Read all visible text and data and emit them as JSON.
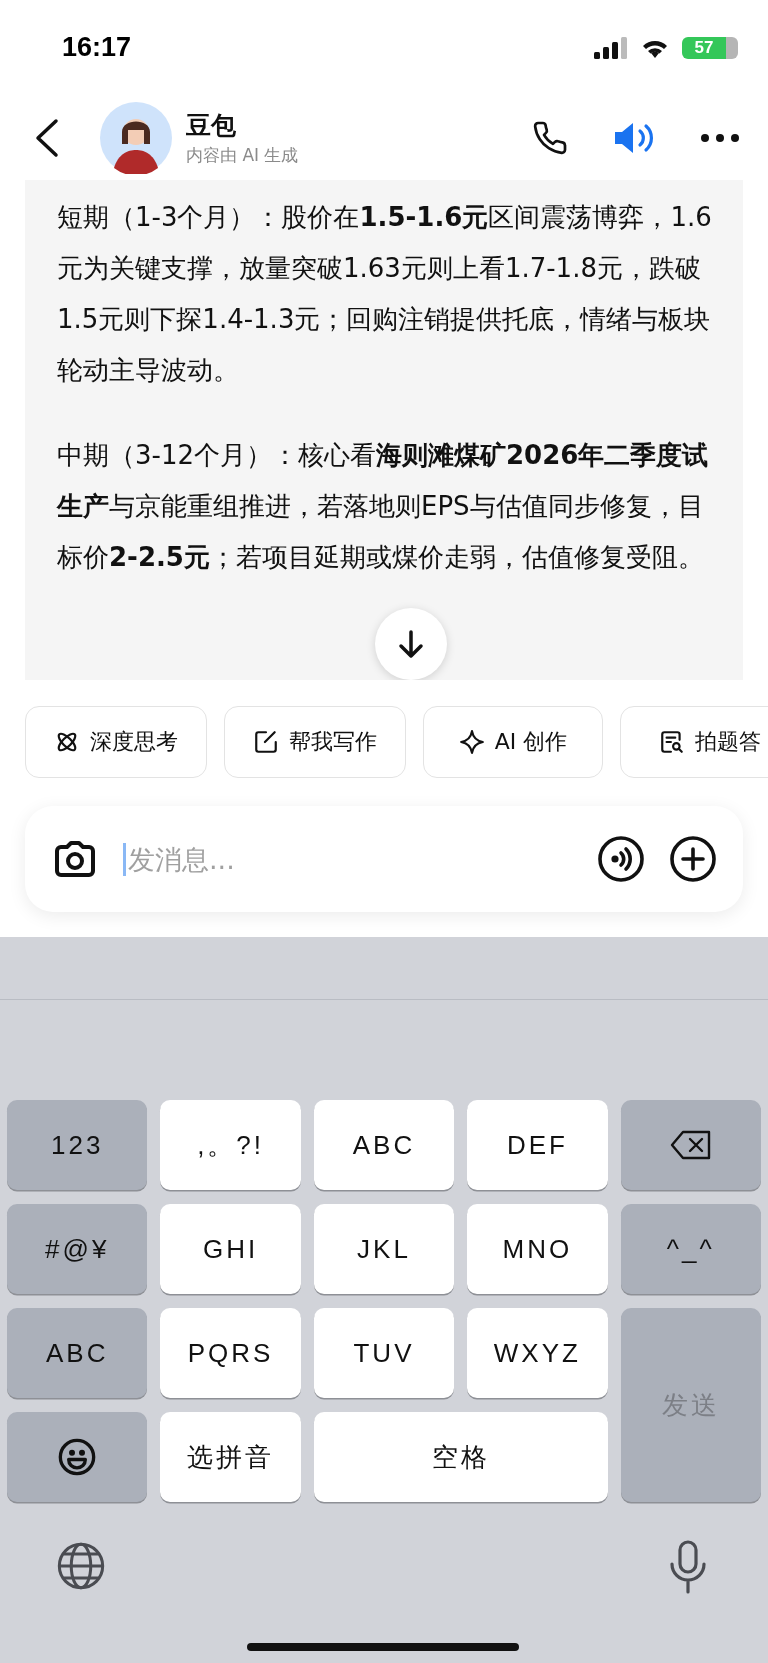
{
  "status_bar": {
    "time": "16:17",
    "battery": "57"
  },
  "header": {
    "title": "豆包",
    "subtitle": "内容由 AI 生成"
  },
  "message": {
    "paragraphs": [
      "短期（1-3个月）：股价在**1.5-1.6元**区间震荡博弈，1.6元为关键支撑，放量突破1.63元则上看1.7-1.8元，跌破1.5元则下探1.4-1.3元；回购注销提供托底，情绪与板块轮动主导波动。",
      "中期（3-12个月）：核心看**海则滩煤矿2026年二季度试生产**与京能重组推进，若落地则EPS与估值同步修复，目标价**2-2.5元**；若项目延期或煤价走弱，估值修复受阻。"
    ]
  },
  "chips": [
    {
      "kind": "atom",
      "label": "深度思考"
    },
    {
      "kind": "write",
      "label": "帮我写作"
    },
    {
      "kind": "sparkle",
      "label": "AI 创作"
    },
    {
      "kind": "scan",
      "label": "拍题答"
    }
  ],
  "input": {
    "placeholder": "发消息..."
  },
  "keyboard": {
    "keys": [
      {
        "kind": "function",
        "label": "123"
      },
      {
        "kind": "letter",
        "label": ",。?!"
      },
      {
        "kind": "letter",
        "label": "ABC"
      },
      {
        "kind": "letter",
        "label": "DEF"
      },
      {
        "kind": "backspace"
      },
      {
        "kind": "function",
        "label": "#@¥"
      },
      {
        "kind": "letter",
        "label": "GHI"
      },
      {
        "kind": "letter",
        "label": "JKL"
      },
      {
        "kind": "letter",
        "label": "MNO"
      },
      {
        "kind": "function",
        "label": "^_^"
      },
      {
        "kind": "function",
        "label": "ABC"
      },
      {
        "kind": "letter",
        "label": "PQRS"
      },
      {
        "kind": "letter",
        "label": "TUV"
      },
      {
        "kind": "letter",
        "label": "WXYZ"
      },
      {
        "kind": "send",
        "label": "发送",
        "disabled": true
      },
      {
        "kind": "emoji"
      },
      {
        "kind": "letter",
        "label": "选拼音"
      },
      {
        "kind": "space",
        "label": "空格"
      }
    ]
  }
}
